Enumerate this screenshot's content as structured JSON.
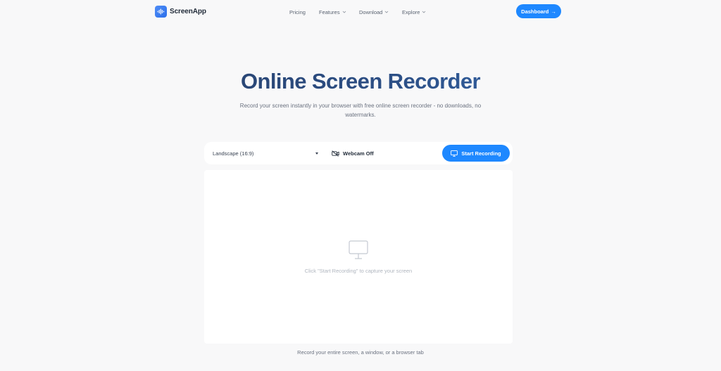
{
  "header": {
    "brand": "ScreenApp",
    "nav": [
      {
        "label": "Pricing"
      },
      {
        "label": "Features"
      },
      {
        "label": "Download"
      },
      {
        "label": "Explore"
      }
    ],
    "dashboard_label": "Dashboard",
    "dashboard_arrow": "→"
  },
  "hero": {
    "title": "Online Screen Recorder",
    "subtitle": "Record your screen instantly in your browser with free online screen recorder - no downloads, no watermarks."
  },
  "controls": {
    "layout_selected": "Landscape (16:9)",
    "webcam_label": "Webcam Off",
    "start_label": "Start Recording"
  },
  "preview": {
    "placeholder": "Click \"Start Recording\" to capture your screen"
  },
  "footer": {
    "note": "Record your entire screen, a window, or a browser tab"
  },
  "colors": {
    "accent": "#1e88ff",
    "background": "#f8f8f9",
    "title_gradient_start": "#273a5e",
    "title_gradient_end": "#3a79c8"
  },
  "icons": {
    "brand": "soundwave-logo-icon",
    "chevron": "chevron-down-icon",
    "select_caret": "caret-down-icon",
    "webcam": "video-off-icon",
    "start": "monitor-icon",
    "preview": "monitor-icon"
  }
}
